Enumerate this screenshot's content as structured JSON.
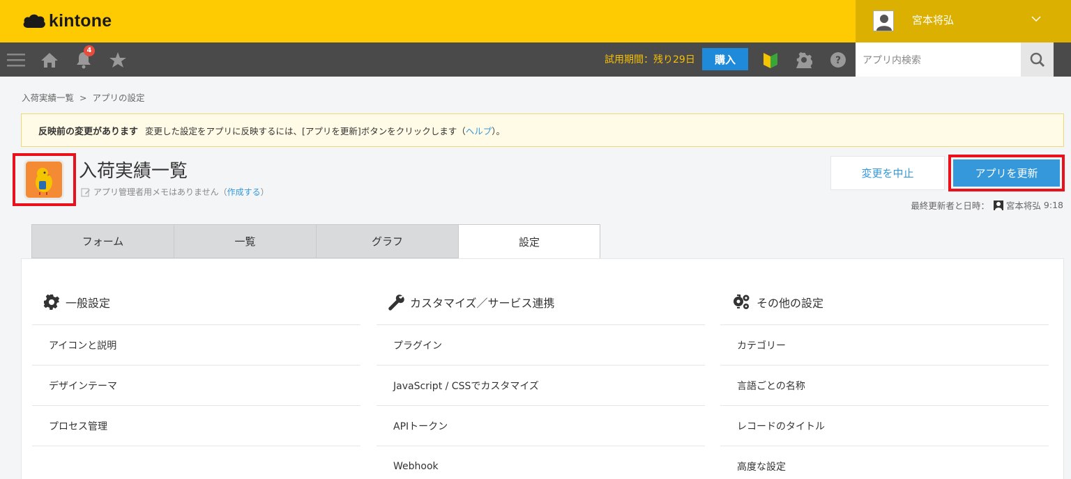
{
  "brand": {
    "name": "kintone"
  },
  "user": {
    "name": "宮本将弘"
  },
  "nav": {
    "notification_count": "4"
  },
  "trial": {
    "text": "試用期間：残り29日",
    "buy_label": "購入"
  },
  "search": {
    "placeholder": "アプリ内検索"
  },
  "breadcrumb": {
    "items": [
      "入荷実績一覧",
      "アプリの設定"
    ],
    "separator": ">"
  },
  "notice": {
    "title": "反映前の変更があります",
    "text_before": "変更した設定をアプリに反映するには、[アプリを更新]ボタンをクリックします（",
    "link": "ヘルプ",
    "text_after": "）。"
  },
  "app": {
    "title": "入荷実績一覧",
    "memo_text": "アプリ管理者用メモはありません（",
    "memo_link": "作成する",
    "memo_close": "）"
  },
  "actions": {
    "cancel_label": "変更を中止",
    "update_label": "アプリを更新"
  },
  "last_updated": {
    "label": "最終更新者と日時：",
    "user": "宮本将弘",
    "time": "9:18"
  },
  "tabs": [
    "フォーム",
    "一覧",
    "グラフ",
    "設定"
  ],
  "columns": [
    {
      "heading": "一般設定",
      "icon": "gear-icon",
      "items": [
        "アイコンと説明",
        "デザインテーマ",
        "プロセス管理"
      ]
    },
    {
      "heading": "カスタマイズ／サービス連携",
      "icon": "wrench-icon",
      "items": [
        "プラグイン",
        "JavaScript / CSSでカスタマイズ",
        "APIトークン",
        "Webhook"
      ]
    },
    {
      "heading": "その他の設定",
      "icon": "gears-icon",
      "items": [
        "カテゴリー",
        "言語ごとの名称",
        "レコードのタイトル",
        "高度な設定"
      ]
    }
  ],
  "colors": {
    "topbar": "#fecb02",
    "navbar": "#4a4a4a",
    "accent": "#3498db",
    "highlight": "#e8111c"
  }
}
